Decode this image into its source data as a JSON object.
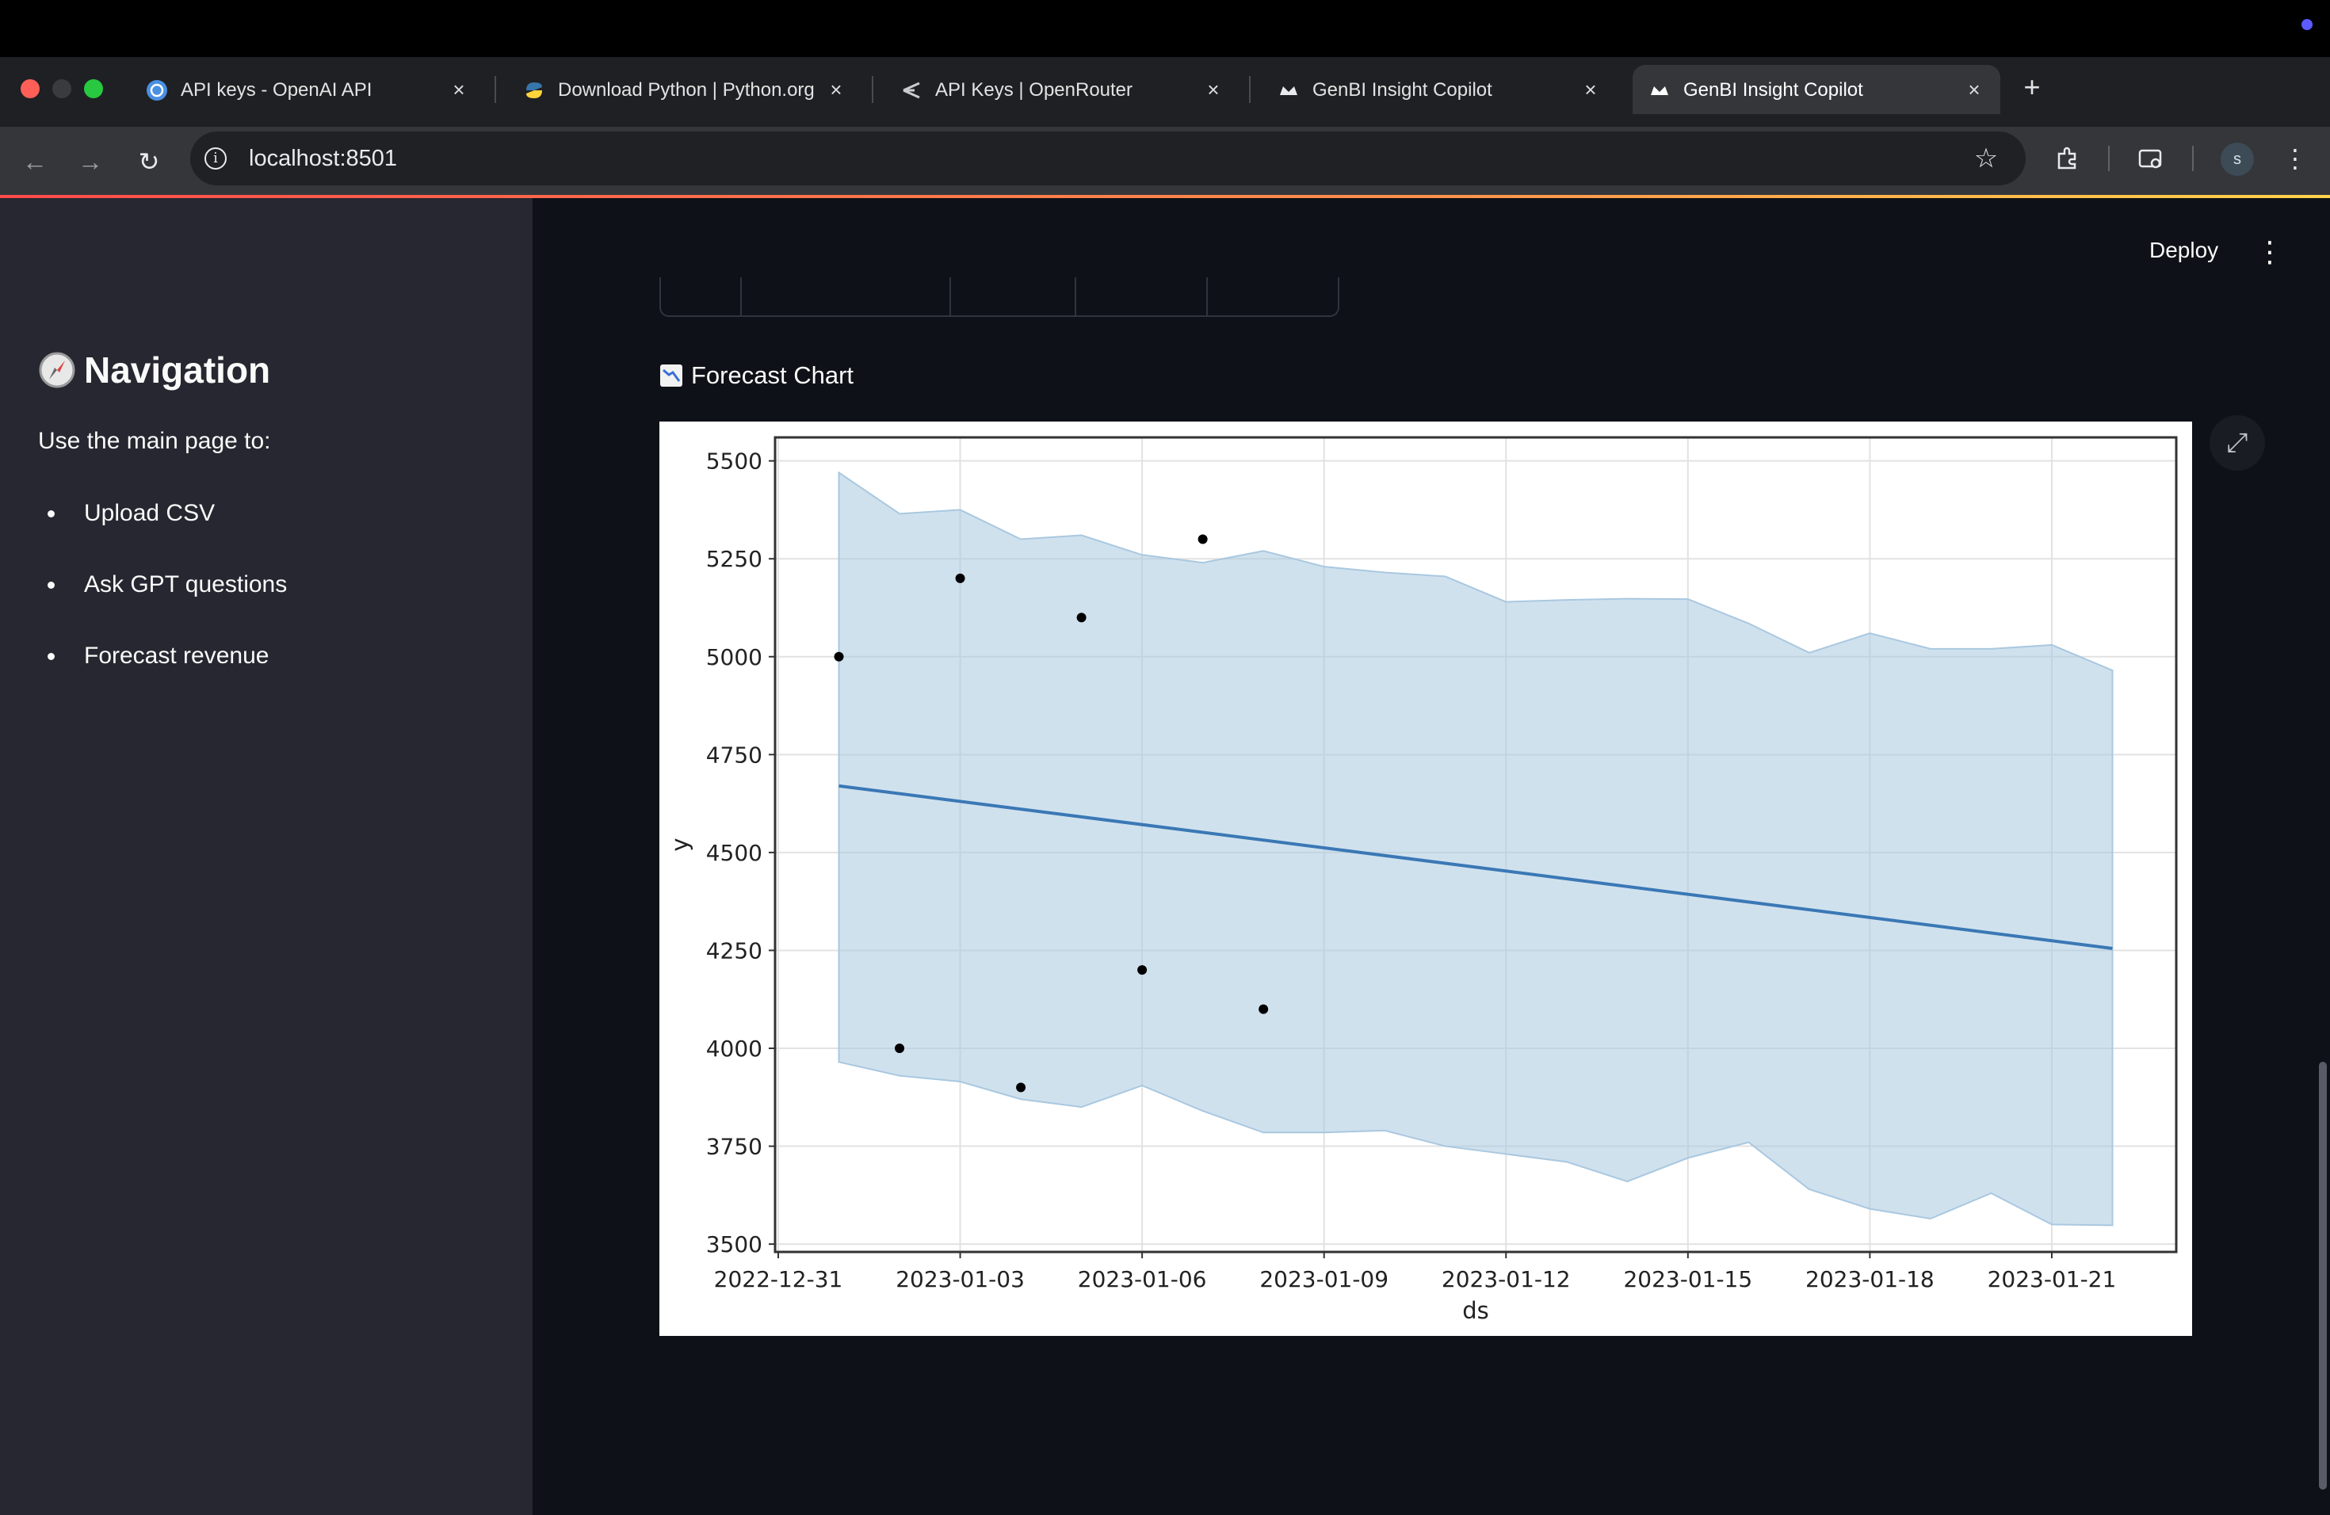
{
  "browser": {
    "tabs": [
      {
        "title": "API keys - OpenAI API",
        "favicon": "openai-icon",
        "active": false
      },
      {
        "title": "Download Python | Python.org",
        "favicon": "python-icon",
        "active": false
      },
      {
        "title": "API Keys | OpenRouter",
        "favicon": "openrouter-icon",
        "active": false
      },
      {
        "title": "GenBI Insight Copilot",
        "favicon": "streamlit-icon",
        "active": false
      },
      {
        "title": "GenBI Insight Copilot",
        "favicon": "streamlit-icon",
        "active": true
      }
    ],
    "url": "localhost:8501",
    "profile_initial": "s"
  },
  "sidebar": {
    "title": "Navigation",
    "intro": "Use the main page to:",
    "items": [
      "Upload CSV",
      "Ask GPT questions",
      "Forecast revenue"
    ]
  },
  "header": {
    "deploy_label": "Deploy"
  },
  "main": {
    "section_title": "Forecast Chart"
  },
  "chart_data": {
    "type": "line",
    "xlabel": "ds",
    "ylabel": "y",
    "x_tick_labels": [
      "2022-12-31",
      "2023-01-03",
      "2023-01-06",
      "2023-01-09",
      "2023-01-12",
      "2023-01-15",
      "2023-01-18",
      "2023-01-21"
    ],
    "y_ticks": [
      3500,
      3750,
      4000,
      4250,
      4500,
      4750,
      5000,
      5250,
      5500
    ],
    "xlim": [
      "2022-12-31",
      "2023-01-23"
    ],
    "ylim": [
      3480,
      5560
    ],
    "grid": true,
    "observed": {
      "x": [
        "2023-01-01",
        "2023-01-02",
        "2023-01-03",
        "2023-01-04",
        "2023-01-05",
        "2023-01-06",
        "2023-01-07",
        "2023-01-08"
      ],
      "y": [
        5000,
        4000,
        5200,
        3900,
        5100,
        4200,
        5300,
        4100
      ],
      "color": "#000000"
    },
    "forecast": {
      "x": [
        "2023-01-01",
        "2023-01-22"
      ],
      "y": [
        4670,
        4255
      ],
      "color": "#3a78b5"
    },
    "interval": {
      "x": [
        "2023-01-01",
        "2023-01-02",
        "2023-01-03",
        "2023-01-04",
        "2023-01-05",
        "2023-01-06",
        "2023-01-07",
        "2023-01-08",
        "2023-01-09",
        "2023-01-10",
        "2023-01-11",
        "2023-01-12",
        "2023-01-13",
        "2023-01-14",
        "2023-01-15",
        "2023-01-16",
        "2023-01-17",
        "2023-01-18",
        "2023-01-19",
        "2023-01-20",
        "2023-01-21",
        "2023-01-22"
      ],
      "upper": [
        5470,
        5365,
        5375,
        5300,
        5310,
        5260,
        5240,
        5270,
        5230,
        5215,
        5205,
        5140,
        5145,
        5148,
        5147,
        5085,
        5010,
        5060,
        5020,
        5020,
        5030,
        4965
      ],
      "lower": [
        3965,
        3930,
        3915,
        3870,
        3850,
        3905,
        3840,
        3785,
        3785,
        3790,
        3750,
        3730,
        3710,
        3660,
        3720,
        3760,
        3640,
        3590,
        3565,
        3630,
        3550,
        3548
      ],
      "color": "#a9c8e0"
    }
  }
}
